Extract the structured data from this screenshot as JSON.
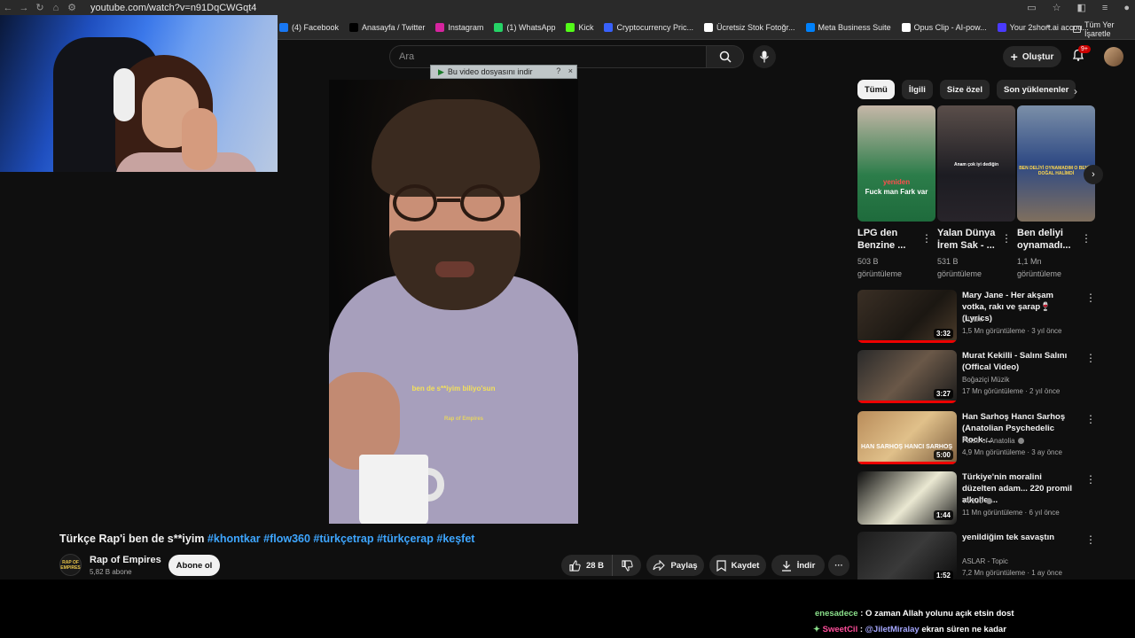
{
  "browser": {
    "url": "youtube.com/watch?v=n91DqCWGqt4",
    "bookmarks": [
      {
        "label": "(4) Facebook",
        "color": "#1877f2"
      },
      {
        "label": "Anasayfa / Twitter",
        "color": "#000000"
      },
      {
        "label": "Instagram",
        "color": "#d6249f"
      },
      {
        "label": "(1) WhatsApp",
        "color": "#25d366"
      },
      {
        "label": "Kick",
        "color": "#53fc18"
      },
      {
        "label": "Cryptocurrency Pric...",
        "color": "#3861fb"
      },
      {
        "label": "Ücretsiz Stok Fotoğr...",
        "color": "#ffffff"
      },
      {
        "label": "Meta Business Suite",
        "color": "#0081fb"
      },
      {
        "label": "Opus Clip - AI-pow...",
        "color": "#ffffff"
      },
      {
        "label": "Your 2short.ai accou...",
        "color": "#4a3aff"
      }
    ],
    "more_bookmarks": "»",
    "all_bookmarks": "Tüm Yer İşaretle"
  },
  "youtube": {
    "search_placeholder": "Ara",
    "create_label": "Oluştur",
    "notif_badge": "9+",
    "download_bar": "Bu video dosyasını indir",
    "download_bar_help": "?",
    "download_bar_close": "×"
  },
  "video": {
    "subtitle": "ben de s**iyim biliyo'sun",
    "watermark": "Rap of Empires",
    "title_plain": "Türkçe Rap'i ben de s**iyim ",
    "hashtags": "#khontkar #flow360 #türkçetrap #türkçerap #keşfet",
    "channel_name": "Rap of Empires",
    "channel_avatar_text": "RAP OF EMPIRES",
    "subscribers": "5,82 B abone",
    "subscribe_label": "Abone ol",
    "likes": "28 B",
    "share_label": "Paylaş",
    "save_label": "Kaydet",
    "download_label": "İndir"
  },
  "sidebar": {
    "chips": [
      "Tümü",
      "İlgili",
      "Size özel",
      "Son yüklenenler"
    ],
    "shorts": [
      {
        "title": "LPG den Benzine ...",
        "views": "503 B görüntüleme",
        "caption1": "yeniden",
        "caption2": "Fuck man Fark var"
      },
      {
        "title": "Yalan Dünya İrem Sak - ...",
        "views": "531 B görüntüleme",
        "caption1": "Anam çok iyi dediğin"
      },
      {
        "title": "Ben deliyi oynamadı...",
        "views": "1,1 Mn görüntüleme",
        "caption1": "BEN DELİYİ OYNAMADIM O BENİM DOĞAL HALİMDİ"
      }
    ],
    "recommendations": [
      {
        "title": "Mary Jane - Her akşam votka, rakı ve şarap🍷 (Lyrics)",
        "channel": "LiLium",
        "verified": false,
        "meta": "1,5 Mn görüntüleme · 3 yıl önce",
        "duration": "3:32",
        "thumb": "linear-gradient(135deg,#3a2f25,#1b1712 60%,#4b3b2a)"
      },
      {
        "title": "Murat Kekilli - Salını Salını (Offical Video)",
        "channel": "Boğaziçi Müzik",
        "verified": false,
        "meta": "17 Mn görüntüleme · 2 yıl önce",
        "duration": "3:27",
        "thumb": "linear-gradient(135deg,#2a2a2a,#6a5848 50%,#1a1a1a)"
      },
      {
        "title": "Han Sarhoş Hancı Sarhoş (Anatolian Psychedelic Rock-...",
        "channel": "Pulse of Anatolia",
        "verified": true,
        "meta": "4,9 Mn görüntüleme · 3 ay önce",
        "duration": "5:00",
        "thumb": "linear-gradient(135deg,#b98c5a,#e0c08a 50%,#7a5b3b)",
        "thumb_text": "HAN SARHOŞ HANCI SARHOŞ"
      },
      {
        "title": "Türkiye'nin moralini düzelten adam... 220 promil alkolle ...",
        "channel": "TV100",
        "verified": true,
        "meta": "11 Mn görüntüleme · 6 yıl önce",
        "duration": "1:44",
        "thumb": "linear-gradient(135deg,#0d0d0d,#eae8d2 55%,#1a1a1a)"
      },
      {
        "title": "yenildiğim tek savaştın",
        "channel": "ASLAR - Topic",
        "verified": false,
        "meta": "7,2 Mn görüntüleme · 1 ay önce",
        "duration": "1:52",
        "thumb": "linear-gradient(135deg,#1c1c1c,#3a3a3a 50%,#0a0a0a)"
      }
    ]
  },
  "chat": [
    {
      "user": "enesadece",
      "message": " : O zaman Allah yolunu açık etsin dost"
    },
    {
      "user": "SweetCil",
      "mention": "@JiletMiralay",
      "message": " ekran süren ne kadar"
    }
  ]
}
